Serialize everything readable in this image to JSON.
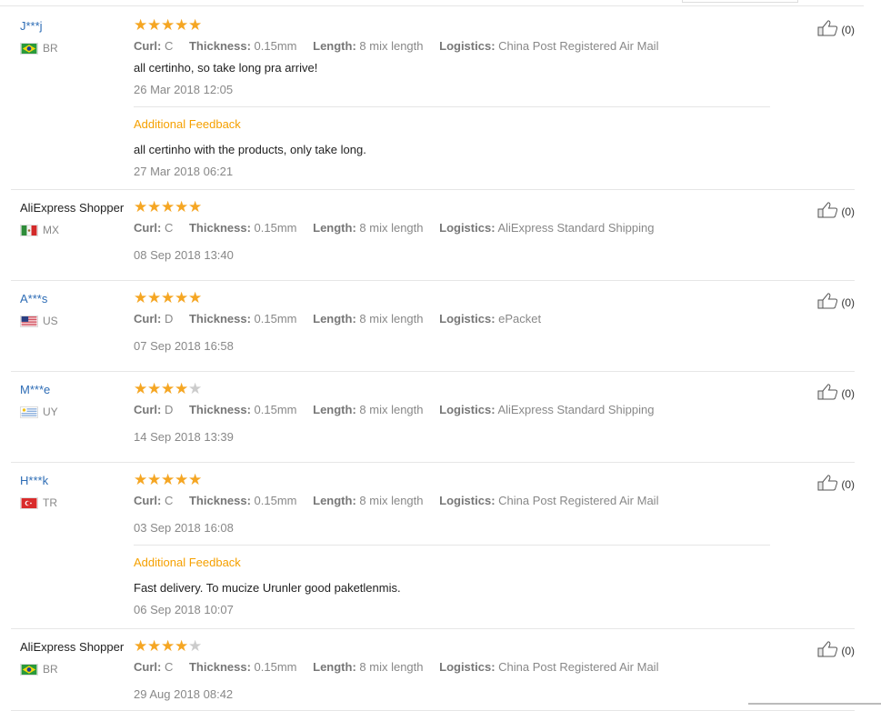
{
  "reviews": [
    {
      "user": "J***j",
      "user_style": "link",
      "country": "BR",
      "flag": "br",
      "stars": 5,
      "attrs": {
        "curl_k": "Curl:",
        "curl": "C",
        "thick_k": "Thickness:",
        "thick": "0.15mm",
        "len_k": "Length:",
        "len": "8 mix length",
        "log_k": "Logistics:",
        "log": "China Post Registered Air Mail"
      },
      "feedback": "all certinho, so take long pra arrive!",
      "date": "26 Mar 2018 12:05",
      "additional": {
        "title": "Additional Feedback",
        "text": "all certinho with the products, only take long.",
        "date": "27 Mar 2018 06:21"
      },
      "likes": "(0)"
    },
    {
      "user": "AliExpress Shopper",
      "user_style": "plain",
      "country": "MX",
      "flag": "mx",
      "stars": 5,
      "attrs": {
        "curl_k": "Curl:",
        "curl": "C",
        "thick_k": "Thickness:",
        "thick": "0.15mm",
        "len_k": "Length:",
        "len": "8 mix length",
        "log_k": "Logistics:",
        "log": "AliExpress Standard Shipping"
      },
      "feedback": "",
      "date": "08 Sep 2018 13:40",
      "likes": "(0)"
    },
    {
      "user": "A***s",
      "user_style": "link",
      "country": "US",
      "flag": "us",
      "stars": 5,
      "attrs": {
        "curl_k": "Curl:",
        "curl": "D",
        "thick_k": "Thickness:",
        "thick": "0.15mm",
        "len_k": "Length:",
        "len": "8 mix length",
        "log_k": "Logistics:",
        "log": "ePacket"
      },
      "feedback": "",
      "date": "07 Sep 2018 16:58",
      "likes": "(0)"
    },
    {
      "user": "M***e",
      "user_style": "link",
      "country": "UY",
      "flag": "uy",
      "stars": 4,
      "attrs": {
        "curl_k": "Curl:",
        "curl": "D",
        "thick_k": "Thickness:",
        "thick": "0.15mm",
        "len_k": "Length:",
        "len": "8 mix length",
        "log_k": "Logistics:",
        "log": "AliExpress Standard Shipping"
      },
      "feedback": "",
      "date": "14 Sep 2018 13:39",
      "likes": "(0)"
    },
    {
      "user": "H***k",
      "user_style": "link",
      "country": "TR",
      "flag": "tr",
      "stars": 5,
      "attrs": {
        "curl_k": "Curl:",
        "curl": "C",
        "thick_k": "Thickness:",
        "thick": "0.15mm",
        "len_k": "Length:",
        "len": "8 mix length",
        "log_k": "Logistics:",
        "log": "China Post Registered Air Mail"
      },
      "feedback": "",
      "date": "03 Sep 2018 16:08",
      "additional": {
        "title": "Additional Feedback",
        "text": "Fast delivery. To mucize Urunler good paketlenmis.",
        "date": "06 Sep 2018 10:07"
      },
      "likes": "(0)"
    },
    {
      "user": "AliExpress Shopper",
      "user_style": "plain",
      "country": "BR",
      "flag": "br",
      "stars": 4,
      "attrs": {
        "curl_k": "Curl:",
        "curl": "C",
        "thick_k": "Thickness:",
        "thick": "0.15mm",
        "len_k": "Length:",
        "len": "8 mix length",
        "log_k": "Logistics:",
        "log": "China Post Registered Air Mail"
      },
      "feedback": "",
      "date": "29 Aug 2018 08:42",
      "likes": "(0)"
    }
  ]
}
